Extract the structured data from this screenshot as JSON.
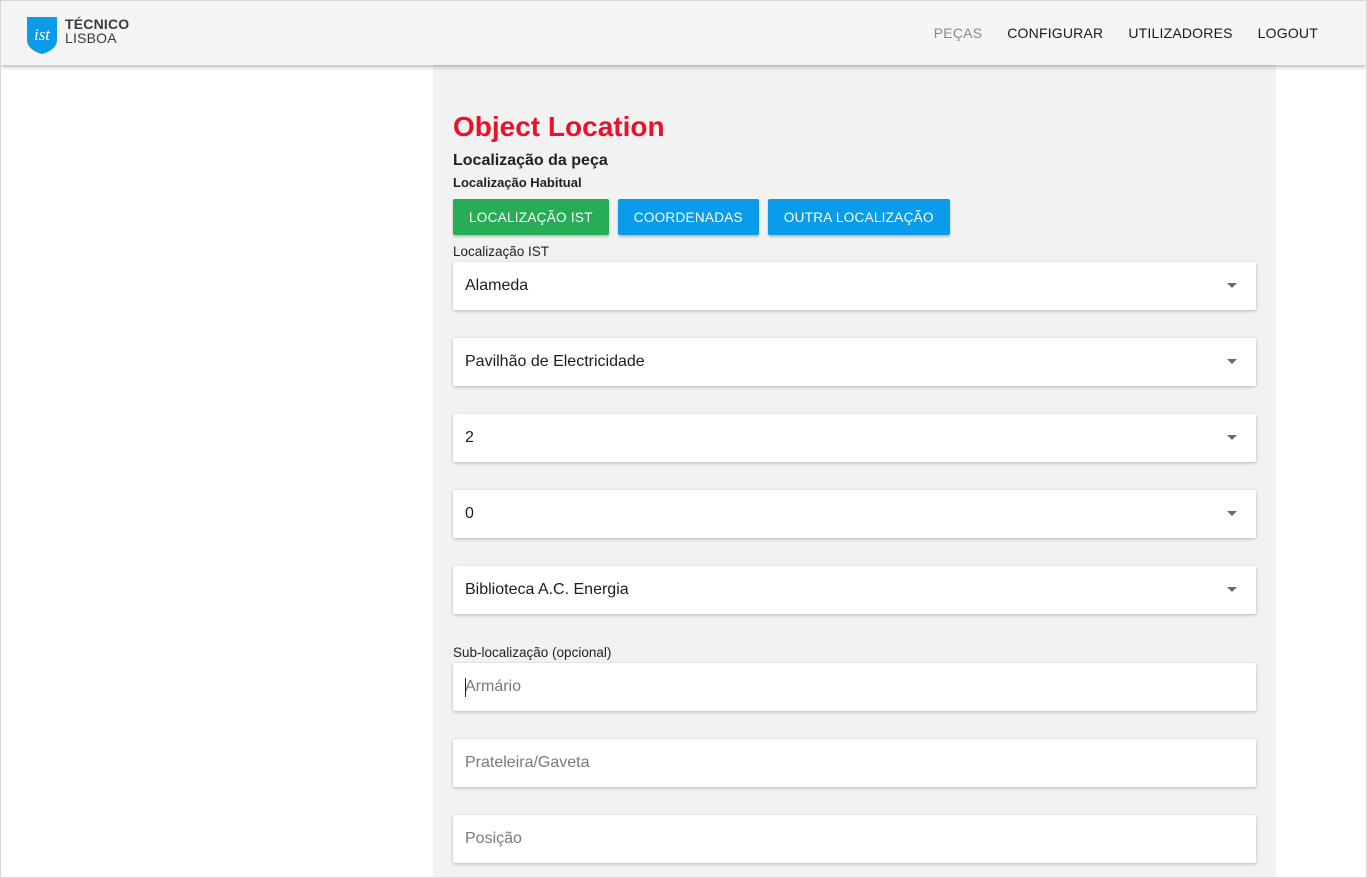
{
  "header": {
    "logo_line1": "TÉCNICO",
    "logo_line2": "LISBOA",
    "nav": [
      {
        "label": "PEÇAS",
        "active": true
      },
      {
        "label": "CONFIGURAR",
        "active": false
      },
      {
        "label": "UTILIZADORES",
        "active": false
      },
      {
        "label": "LOGOUT",
        "active": false
      }
    ]
  },
  "page": {
    "title": "Object Location",
    "subtitle": "Localização da peça",
    "section_label": "Localização Habitual",
    "buttons": {
      "ist": "LOCALIZAÇÃO IST",
      "coords": "COORDENADAS",
      "other": "OUTRA LOCALIZAÇÃO"
    },
    "ist_label": "Localização IST",
    "selects": {
      "campus": "Alameda",
      "building": "Pavilhão de Electricidade",
      "floor": "2",
      "room_level": "0",
      "room": "Biblioteca A.C. Energia"
    },
    "sublocation_label": "Sub-localização (opcional)",
    "inputs": {
      "cabinet_placeholder": "Armário",
      "cabinet_value": "",
      "shelf_placeholder": "Prateleira/Gaveta",
      "shelf_value": "",
      "position_placeholder": "Posição",
      "position_value": ""
    }
  },
  "colors": {
    "title_red": "#e8132a",
    "button_green": "#26ad55",
    "button_blue": "#0a9cea",
    "logo_blue": "#0a9cea",
    "panel_bg": "#f2f2f2",
    "header_bg": "#f5f5f5"
  },
  "icons": {
    "logo": "ist-shield-logo",
    "select_arrow": "caret-down-icon"
  }
}
